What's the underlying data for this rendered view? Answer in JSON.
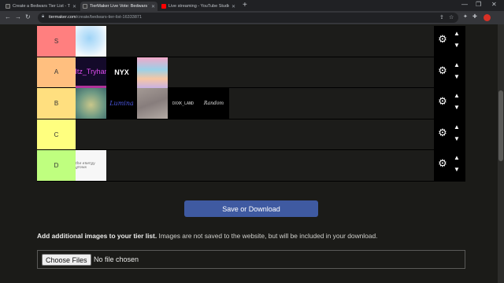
{
  "browser": {
    "tabs": [
      {
        "title": "Create a Bedwars Tier List - Tier",
        "favicon_color": "#2a2a2a",
        "active": false
      },
      {
        "title": "TierMaker Live Vote: Bedwars Ti",
        "favicon_color": "#2a2a2a",
        "active": true
      },
      {
        "title": "Live streaming - YouTube Studio",
        "favicon_color": "#ff0000",
        "active": false
      }
    ],
    "new_tab": "+",
    "url_host": "tiermaker.com",
    "url_path": "/create/bedwars-tier-list-16333871"
  },
  "tiers": [
    {
      "label": "S",
      "color": "#ff7f7f",
      "items": [
        {
          "name": "blue-watercolor-image",
          "text": ""
        }
      ]
    },
    {
      "label": "A",
      "color": "#ffbf7f",
      "items": [
        {
          "name": "itz-tryhard-image",
          "text": "Itz_Tryhar"
        },
        {
          "name": "nyx-image",
          "text": "NYX"
        },
        {
          "name": "pastel-sky-image",
          "text": ""
        }
      ]
    },
    {
      "label": "B",
      "color": "#ffdf7f",
      "items": [
        {
          "name": "green-sky-image",
          "text": ""
        },
        {
          "name": "signature-image",
          "text": "Lumina"
        },
        {
          "name": "faded-photo-image",
          "text": ""
        },
        {
          "name": "dxxk-land-image",
          "text": "DXXK_LAND"
        },
        {
          "name": "random-image",
          "text": "Random"
        }
      ]
    },
    {
      "label": "C",
      "color": "#ffff7f",
      "items": []
    },
    {
      "label": "D",
      "color": "#bfff7f",
      "items": [
        {
          "name": "handwriting-image",
          "text": "the energy grows"
        }
      ]
    }
  ],
  "save_button": "Save or Download",
  "info": {
    "bold": "Add additional images to your tier list.",
    "rest": " Images are not saved to the website, but will be included in your download."
  },
  "upload": {
    "button": "Choose Files",
    "status": "No file chosen"
  },
  "icons": {
    "gear": "gear-icon",
    "up": "chevron-up-icon",
    "down": "chevron-down-icon"
  }
}
